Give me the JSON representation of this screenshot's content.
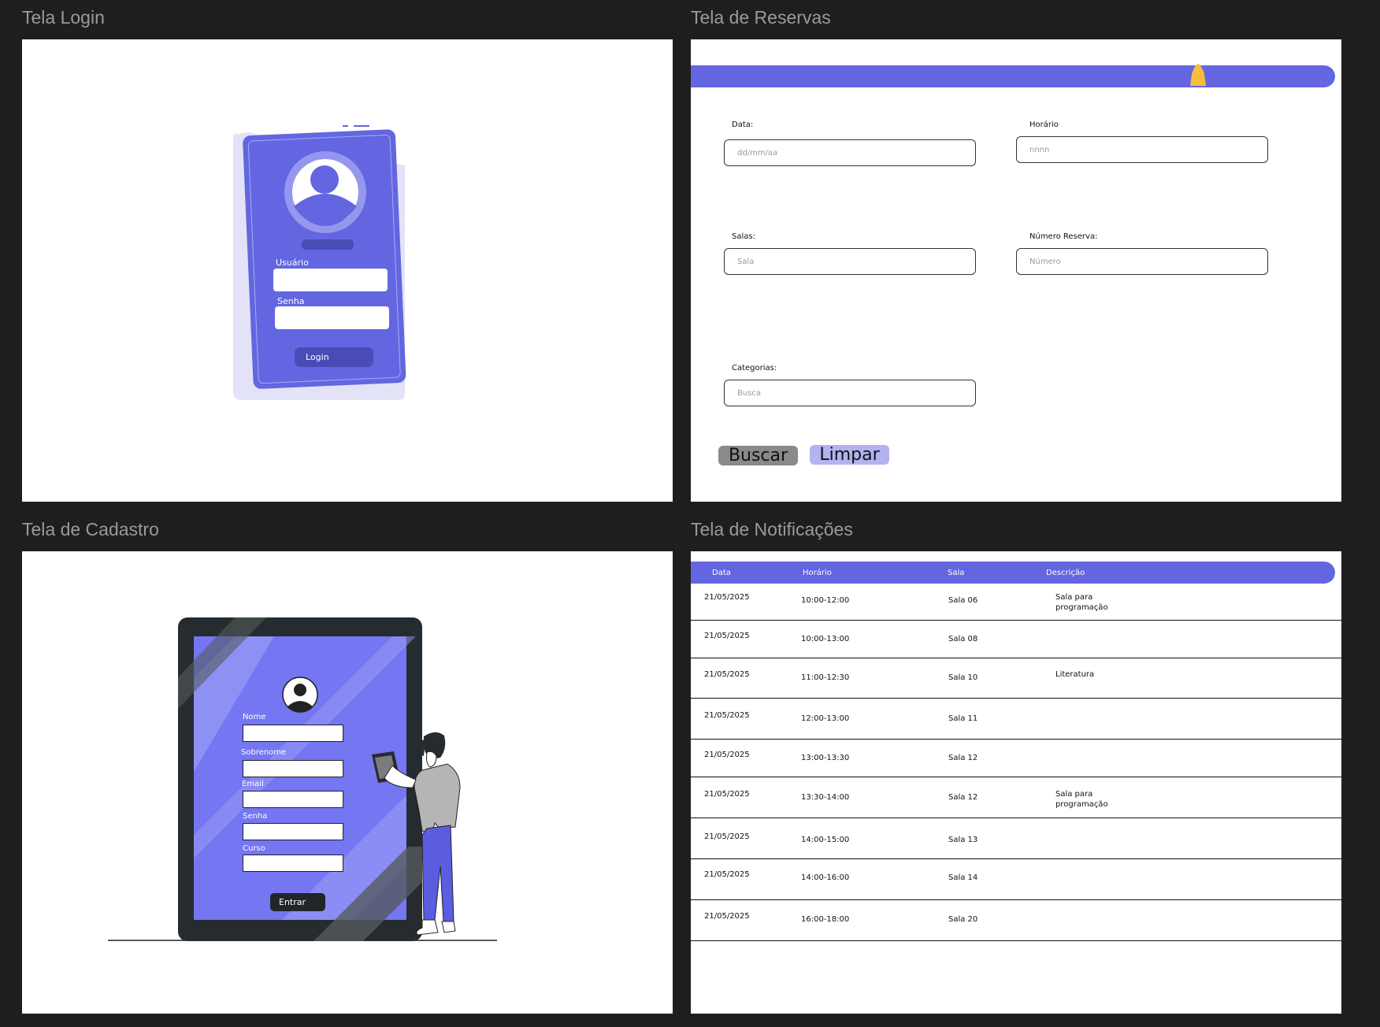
{
  "frames": {
    "login": {
      "title": "Tela Login",
      "user_label": "Usuário",
      "password_label": "Senha",
      "login_button": "Login"
    },
    "reservas": {
      "title": "Tela de Reservas",
      "date_label": "Data:",
      "date_placeholder": "dd/mm/aa",
      "time_label": "Horário",
      "time_placeholder": "nnnn",
      "rooms_label": "Salas:",
      "rooms_placeholder": "Sala",
      "reservation_number_label": "Número Reserva:",
      "reservation_number_placeholder": "Número",
      "categories_label": "Categorias:",
      "categories_placeholder": "Busca",
      "search_button": "Buscar",
      "clear_button": "Limpar",
      "accent_color": "#6366e0",
      "bell_color": "#f7bd3e"
    },
    "cadastro": {
      "title": "Tela de Cadastro",
      "fields": [
        "Nome",
        "Sobrenome",
        "Email",
        "Senha",
        "Curso"
      ],
      "submit_button": "Entrar"
    },
    "notificacoes": {
      "title": "Tela de Notificações",
      "columns": [
        "Data",
        "Horário",
        "Sala",
        "Descrição"
      ],
      "rows": [
        {
          "date": "21/05/2025",
          "time": "10:00-12:00",
          "room": "Sala 06",
          "desc": "Sala para\nprogramação"
        },
        {
          "date": "21/05/2025",
          "time": "10:00-13:00",
          "room": "Sala 08",
          "desc": ""
        },
        {
          "date": "21/05/2025",
          "time": "11:00-12:30",
          "room": "Sala 10",
          "desc": "Literatura"
        },
        {
          "date": "21/05/2025",
          "time": "12:00-13:00",
          "room": "Sala 11",
          "desc": ""
        },
        {
          "date": "21/05/2025",
          "time": "13:00-13:30",
          "room": "Sala 12",
          "desc": ""
        },
        {
          "date": "21/05/2025",
          "time": "13:30-14:00",
          "room": "Sala 12",
          "desc": "Sala para\nprogramação"
        },
        {
          "date": "21/05/2025",
          "time": "14:00-15:00",
          "room": "Sala 13",
          "desc": ""
        },
        {
          "date": "21/05/2025",
          "time": "14:00-16:00",
          "room": "Sala 14",
          "desc": ""
        },
        {
          "date": "21/05/2025",
          "time": "16:00-18:00",
          "room": "Sala 20",
          "desc": ""
        }
      ]
    }
  },
  "colors": {
    "canvas_bg": "#1e1e1e",
    "accent": "#6366e0",
    "illustration_blue": "#7476f2"
  }
}
